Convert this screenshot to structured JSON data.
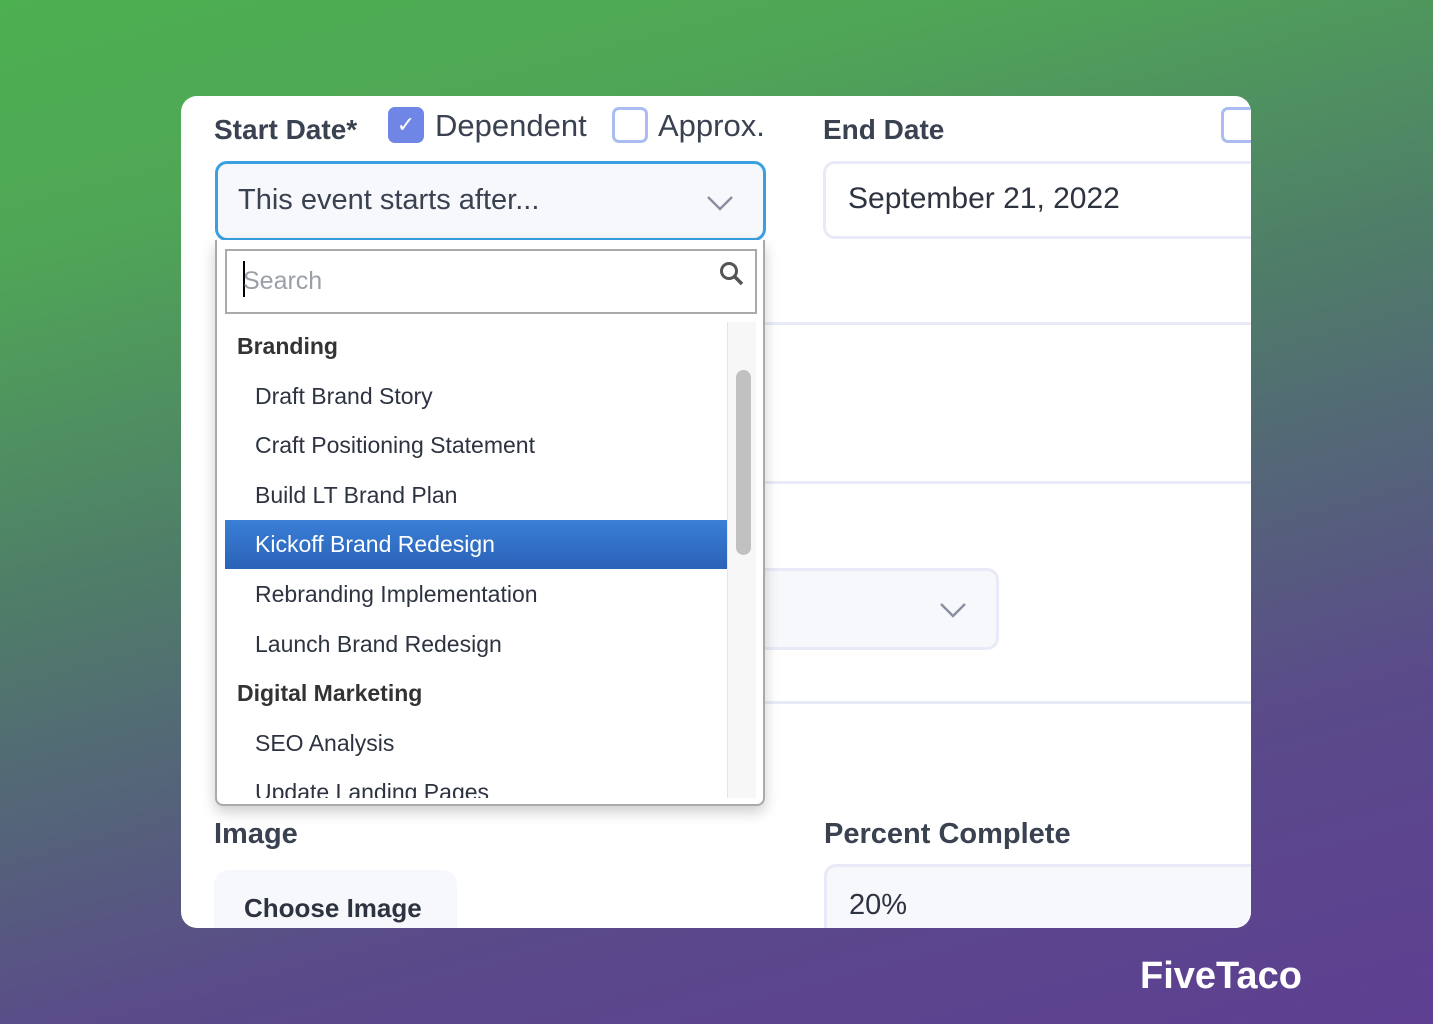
{
  "start_date": {
    "label": "Start Date*",
    "dependent_label": "Dependent",
    "dependent_checked": true,
    "approx_label": "Approx.",
    "approx_checked": false,
    "select_value": "This event starts after..."
  },
  "end_date": {
    "label": "End Date",
    "value": "September 21, 2022"
  },
  "dropdown": {
    "search_placeholder": "Search",
    "items": [
      {
        "label": "Branding",
        "group": true
      },
      {
        "label": "Draft Brand Story"
      },
      {
        "label": "Craft Positioning Statement"
      },
      {
        "label": "Build LT Brand Plan"
      },
      {
        "label": "Kickoff Brand Redesign",
        "selected": true
      },
      {
        "label": "Rebranding Implementation"
      },
      {
        "label": "Launch Brand Redesign"
      },
      {
        "label": "Digital Marketing",
        "group": true
      },
      {
        "label": "SEO Analysis"
      },
      {
        "label": "Update Landing Pages"
      }
    ]
  },
  "image": {
    "label": "Image",
    "button": "Choose Image"
  },
  "percent": {
    "label": "Percent Complete",
    "value": "20%"
  },
  "brand": "FiveTaco",
  "colors": {
    "accent": "#6f86e6",
    "selected": "#2f6cc4",
    "focus": "#3aa0e0"
  }
}
